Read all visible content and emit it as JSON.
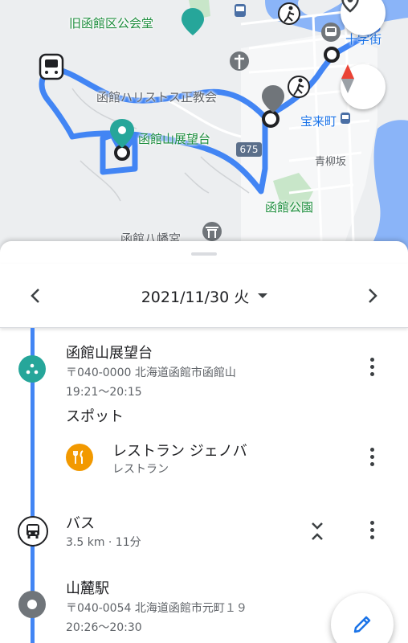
{
  "map": {
    "labels": {
      "old_public_hall": "旧函館区公会堂",
      "orthodox_church": "函館ハリストス正教会",
      "mt_observatory": "函館山展望台",
      "horaicho": "宝来町",
      "aoyagizaka": "青柳坂",
      "hakodate_park": "函館公園",
      "hachimangu": "函館八幡宮",
      "jujigai": "十字街",
      "route_number": "675"
    }
  },
  "date_bar": {
    "date": "2021/11/30 火"
  },
  "timeline": {
    "stop1": {
      "title": "函館山展望台",
      "address": "〒040-0000 北海道函館市函館山",
      "time": "19:21～20:15"
    },
    "spot_header": "スポット",
    "spot": {
      "name": "レストラン ジェノバ",
      "category": "レストラン"
    },
    "transit": {
      "mode": "バス",
      "detail": "3.5 km · 11分"
    },
    "stop2": {
      "title": "山麓駅",
      "address": "〒040-0054 北海道函館市元町１９",
      "time": "20:26～20:30"
    }
  },
  "colors": {
    "route_blue": "#4285f4",
    "water": "#8ab4f8",
    "park": "#c8e6c9",
    "teal": "#26a69a",
    "restaurant": "#f29900"
  },
  "icons": [
    "bus-icon",
    "walk-icon",
    "train-icon",
    "location-pin-icon",
    "compass-icon",
    "church-icon",
    "shrine-icon",
    "fork-knife-icon",
    "more-vert-icon",
    "pencil-icon",
    "chevron-left-icon",
    "chevron-right-icon",
    "dropdown-icon",
    "expand-icon"
  ]
}
